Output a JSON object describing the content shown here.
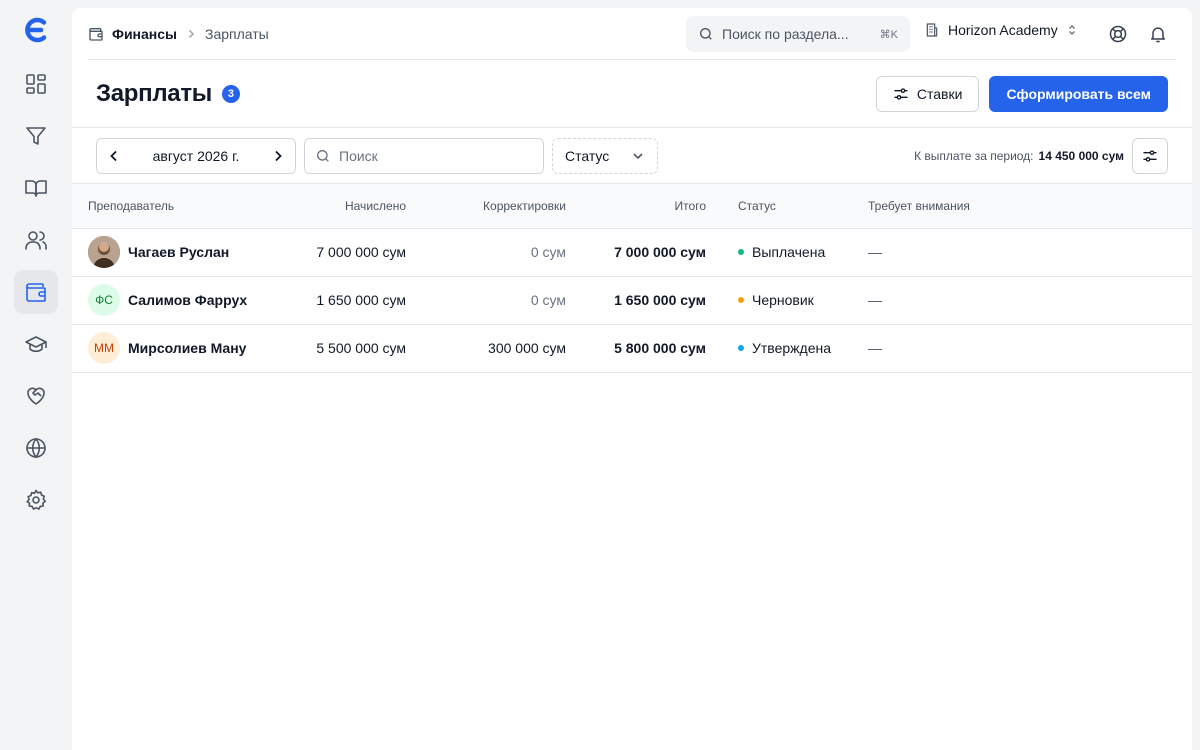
{
  "sidebar": {
    "items": [
      {
        "icon": "dashboard-icon"
      },
      {
        "icon": "funnel-icon"
      },
      {
        "icon": "book-icon"
      },
      {
        "icon": "users-icon"
      },
      {
        "icon": "wallet-icon",
        "active": true
      },
      {
        "icon": "graduation-cap-icon"
      },
      {
        "icon": "heart-handshake-icon"
      },
      {
        "icon": "globe-icon"
      },
      {
        "icon": "gear-icon"
      }
    ]
  },
  "breadcrumb": {
    "parent": "Финансы",
    "current": "Зарплаты"
  },
  "top_search": {
    "placeholder": "Поиск по раздела...",
    "shortcut": "⌘K"
  },
  "org": {
    "name": "Horizon Academy"
  },
  "page": {
    "title": "Зарплаты",
    "count": "3"
  },
  "actions": {
    "rates_label": "Ставки",
    "generate_all_label": "Сформировать всем"
  },
  "toolbar": {
    "month": "август 2026 г.",
    "search_placeholder": "Поиск",
    "status_label": "Статус",
    "payout_label": "К выплате за период:",
    "payout_value": "14 450 000 сум"
  },
  "table": {
    "columns": {
      "teacher": "Преподаватель",
      "accrued": "Начислено",
      "adjustments": "Корректировки",
      "total": "Итого",
      "status": "Статус",
      "attention": "Требует внимания"
    },
    "rows": [
      {
        "name": "Чагаев Руслан",
        "initials": "",
        "photo": true,
        "avatar_bg": "#8a6f5a",
        "avatar_fg": "#ffffff",
        "accrued": "7 000 000 сум",
        "adjustments": "0 сум",
        "total": "7 000 000 сум",
        "status": "Выплачена",
        "status_color": "#10b981",
        "attention": "—"
      },
      {
        "name": "Салимов Фаррух",
        "initials": "ФС",
        "photo": false,
        "avatar_bg": "#dcfce7",
        "avatar_fg": "#15803d",
        "accrued": "1 650 000 сум",
        "adjustments": "0 сум",
        "total": "1 650 000 сум",
        "status": "Черновик",
        "status_color": "#f59e0b",
        "attention": "—"
      },
      {
        "name": "Мирсолиев Ману",
        "initials": "ММ",
        "photo": false,
        "avatar_bg": "#ffedd5",
        "avatar_fg": "#c2410c",
        "accrued": "5 500 000 сум",
        "adjustments": "300 000 сум",
        "total": "5 800 000 сум",
        "status": "Утверждена",
        "status_color": "#0ea5e9",
        "attention": "—"
      }
    ]
  },
  "colors": {
    "accent": "#2563eb",
    "background": "#f3f4f6"
  }
}
